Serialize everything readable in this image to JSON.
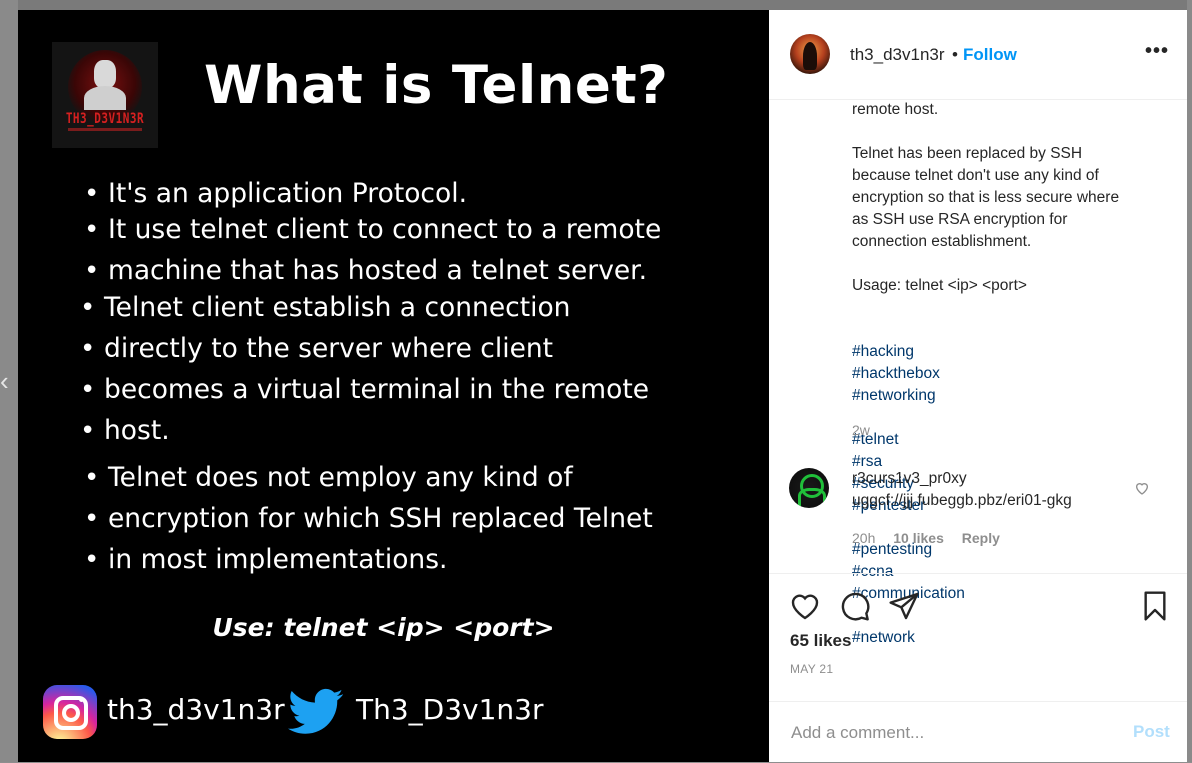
{
  "post_image": {
    "logo_text": "TH3_D3V1N3R",
    "title": "What is Telnet?",
    "bullets": [
      "It's an application Protocol.",
      "It use telnet client to connect to a remote",
      "machine that has hosted a telnet server.",
      "Telnet client establish a connection",
      "directly to the server where client",
      "becomes a virtual terminal in the remote",
      "host.",
      "Telnet does not employ any kind of",
      "encryption for which SSH replaced Telnet",
      "in most implementations."
    ],
    "usage": "Use: telnet <ip> <port>",
    "instagram_handle": "th3_d3v1n3r",
    "twitter_handle": "Th3_D3v1n3r"
  },
  "header": {
    "username": "th3_d3v1n3r",
    "separator": "•",
    "follow_label": "Follow",
    "more_label": "•••"
  },
  "caption": {
    "lines_top": "remote host.",
    "paragraph": "Telnet has been replaced by SSH\nbecause telnet don't use any kind of\nencryption so that is less secure where\nas SSH use RSA encryption for\nconnection establishment.",
    "usage": "Usage: telnet <ip> <port>",
    "hashtags": [
      "#hacking",
      "#hackthebox",
      "#networking",
      "#telnet",
      "#rsa",
      "#security",
      "#pentester",
      "#pentesting",
      "#ccna",
      "#communication",
      "#network"
    ],
    "age": "2w"
  },
  "comment": {
    "username": "r3curs1v3_pr0xy",
    "text": "uggcf://jjj.fubeggb.pbz/eri01-gkg",
    "age": "20h",
    "likes": "10 likes",
    "reply": "Reply"
  },
  "actions": {
    "likes_count": "65 likes",
    "date": "MAY 21"
  },
  "comment_box": {
    "placeholder": "Add a comment...",
    "post_label": "Post"
  },
  "colors": {
    "accent": "#0095f6",
    "hashtag": "#00376b",
    "muted": "#8e8e8e",
    "post_disabled": "#b2dffc"
  }
}
